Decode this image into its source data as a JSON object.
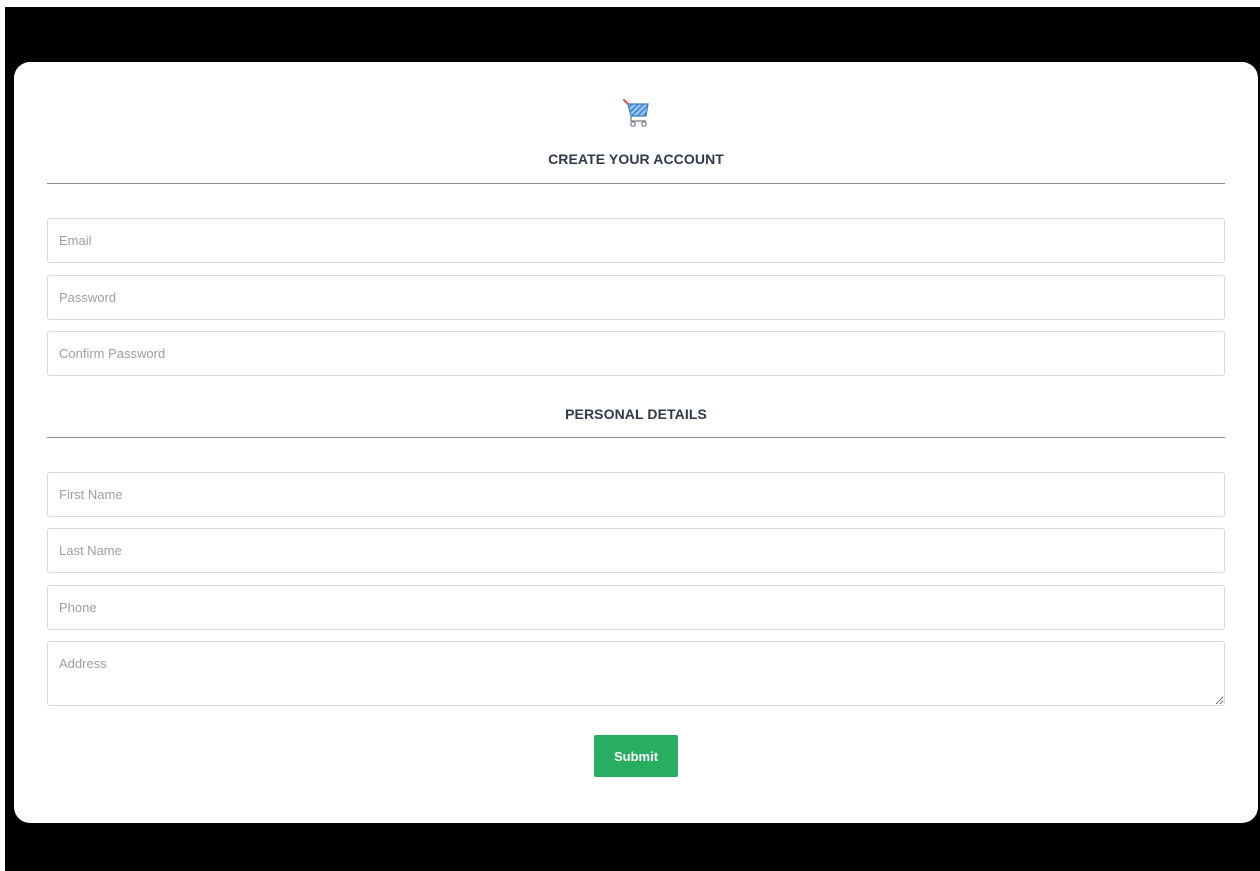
{
  "colors": {
    "page_background": "#000000",
    "card_background": "#ffffff",
    "heading_text": "#2f3a48",
    "placeholder_text": "#9a9fa4",
    "input_border": "#d6d9dc",
    "divider": "#8a8f94",
    "submit_background": "#27ae60",
    "submit_text": "#ffffff",
    "cart_body": "#4a90d9",
    "cart_handle": "#e74c3c"
  },
  "logo": {
    "icon": "shopping-cart-icon"
  },
  "account_section": {
    "title": "CREATE YOUR ACCOUNT",
    "email": {
      "placeholder": "Email",
      "value": ""
    },
    "password": {
      "placeholder": "Password",
      "value": ""
    },
    "confirm_password": {
      "placeholder": "Confirm Password",
      "value": ""
    }
  },
  "personal_section": {
    "title": "PERSONAL DETAILS",
    "first_name": {
      "placeholder": "First Name",
      "value": ""
    },
    "last_name": {
      "placeholder": "Last Name",
      "value": ""
    },
    "phone": {
      "placeholder": "Phone",
      "value": ""
    },
    "address": {
      "placeholder": "Address",
      "value": ""
    }
  },
  "actions": {
    "submit_label": "Submit"
  }
}
